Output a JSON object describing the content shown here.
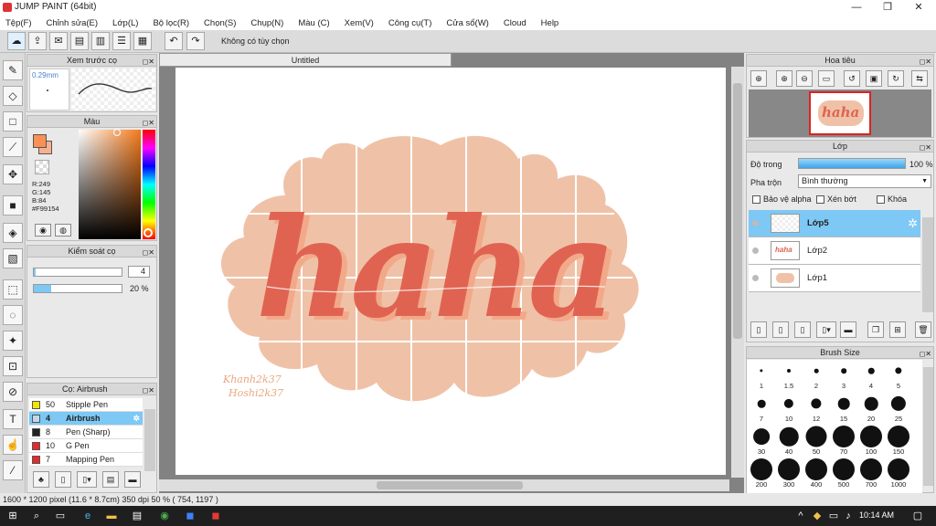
{
  "window": {
    "title": "JUMP PAINT (64bit)",
    "minimize": "—",
    "restore": "❐",
    "close": "✕"
  },
  "menu": [
    "Tệp(F)",
    "Chỉnh sửa(E)",
    "Lớp(L)",
    "Bộ lọc(R)",
    "Chọn(S)",
    "Chụp(N)",
    "Màu (C)",
    "Xem(V)",
    "Công cụ(T)",
    "Cửa sổ(W)",
    "Cloud",
    "Help"
  ],
  "toolbar": {
    "status_text": "Không có tùy chọn"
  },
  "brush_preview": {
    "title": "Xem trước cọ",
    "size": "0.29mm"
  },
  "color_panel": {
    "title": "Màu",
    "r": "R:249",
    "g": "G:145",
    "b": "B:84",
    "hex": "#F99154",
    "fg_color": "#F99154",
    "bg_color": "#F7B190"
  },
  "brush_control": {
    "title": "Kiểm soát cọ",
    "size_value": "4",
    "opacity_value": "20 %",
    "size_fraction": 0.02,
    "opacity_fraction": 0.2
  },
  "brush_list": {
    "title": "Cọ: Airbrush",
    "items": [
      {
        "num": "50",
        "name": "Stipple Pen",
        "color": "#f2e600"
      },
      {
        "num": "4",
        "name": "Airbrush",
        "color": "#c0d8ee"
      },
      {
        "num": "8",
        "name": "Pen (Sharp)",
        "color": "#222222"
      },
      {
        "num": "10",
        "name": "G Pen",
        "color": "#e52a2a"
      },
      {
        "num": "7",
        "name": "Mapping Pen",
        "color": "#e52a2a"
      }
    ]
  },
  "canvas": {
    "tab_title": "Untitled",
    "art_text": "haha",
    "signature_line1": "Khanh2k37",
    "signature_line2": "Hoshi2k37",
    "blob_color": "#efc2a8",
    "text_color": "#e06352",
    "shadow_color": "#f2a98a"
  },
  "navigator": {
    "title": "Hoa tiêu"
  },
  "layers_panel": {
    "title": "Lớp",
    "opacity_label": "Độ trong",
    "opacity_value": "100 %",
    "opacity_fraction": 1.0,
    "blend_label": "Pha trộn",
    "blend_value": "Bình thường",
    "protect_alpha": "Bảo vệ alpha",
    "clipping": "Xén bớt",
    "lock": "Khóa",
    "layers": [
      {
        "name": "Lớp5",
        "selected": true
      },
      {
        "name": "Lớp2",
        "selected": false
      },
      {
        "name": "Lớp1",
        "selected": false
      }
    ]
  },
  "brush_size": {
    "title": "Brush Size",
    "sizes": [
      "1",
      "1.5",
      "2",
      "3",
      "4",
      "5",
      "7",
      "10",
      "12",
      "15",
      "20",
      "25",
      "30",
      "40",
      "50",
      "70",
      "100",
      "150",
      "200",
      "300",
      "400",
      "500",
      "700",
      "1000"
    ]
  },
  "status": {
    "text": "1600 * 1200 pixel  (11.6 * 8.7cm)  350 dpi  50 %  ( 754, 1197 )"
  },
  "taskbar": {
    "time": "10:14 AM"
  }
}
